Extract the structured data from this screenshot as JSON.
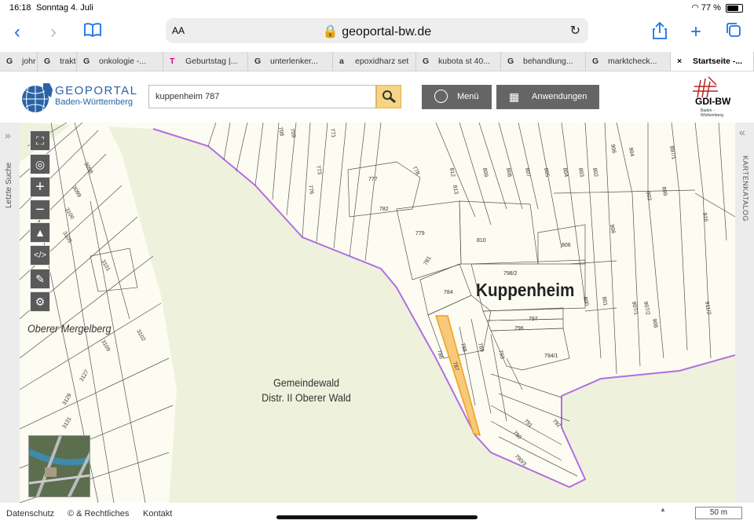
{
  "status": {
    "time": "16:18",
    "date": "Sonntag 4. Juli",
    "battery": "77 %"
  },
  "browser": {
    "url": "geoportal-bw.de",
    "aa": "AA",
    "tabs": [
      {
        "icon": "G",
        "label": "johr"
      },
      {
        "icon": "G",
        "label": "trakto"
      },
      {
        "icon": "G",
        "label": "onkologie -..."
      },
      {
        "icon": "T",
        "label": "Geburtstag |..."
      },
      {
        "icon": "G",
        "label": "unterlenker..."
      },
      {
        "icon": "a",
        "label": "epoxidharz set"
      },
      {
        "icon": "G",
        "label": "kubota st 40..."
      },
      {
        "icon": "G",
        "label": "behandlung..."
      },
      {
        "icon": "G",
        "label": "marktcheck..."
      },
      {
        "icon": "×",
        "label": "Startseite -..."
      }
    ]
  },
  "header": {
    "logo_title": "GEOPORTAL",
    "logo_subtitle": "Baden-Württemberg",
    "search_value": "kuppenheim 787",
    "menu_label": "Menü",
    "apps_label": "Anwendungen",
    "gdi_title": "GDI-BW",
    "gdi_sub1": "Baden -",
    "gdi_sub2": "Württemberg"
  },
  "sidebars": {
    "left_label": "Letzte Suche",
    "right_label": "KARTENKATALOG"
  },
  "map": {
    "town_label": "Kuppenheim",
    "place_label": "Oberer Mergelberg",
    "forest_line1": "Gemeindewald",
    "forest_line2": "Distr. II Oberer Wald",
    "parcels": [
      "708",
      "709",
      "771",
      "773",
      "776",
      "777",
      "778",
      "782",
      "779",
      "781",
      "784",
      "786",
      "787",
      "788",
      "789",
      "793",
      "810",
      "806",
      "798/2",
      "797",
      "796",
      "794/1",
      "791",
      "792",
      "790",
      "790/3",
      "813",
      "812",
      "809",
      "808",
      "807",
      "805",
      "804",
      "803",
      "802",
      "906",
      "904",
      "897/1",
      "903",
      "899",
      "906",
      "800",
      "801",
      "907/1",
      "907/2",
      "908",
      "911/2",
      "916",
      "3098",
      "3099",
      "3100",
      "3101",
      "3102",
      "3105",
      "3109",
      "3127",
      "3129",
      "3131"
    ],
    "scale": "50 m"
  },
  "footer": {
    "privacy": "Datenschutz",
    "legal": "© & Rechtliches",
    "contact": "Kontakt"
  },
  "colors": {
    "brand": "#2a63a5",
    "selected_parcel": "#f7c97b",
    "boundary": "#b06fe0",
    "forest": "#eef2dc",
    "parcels": "#fdfcf2"
  }
}
